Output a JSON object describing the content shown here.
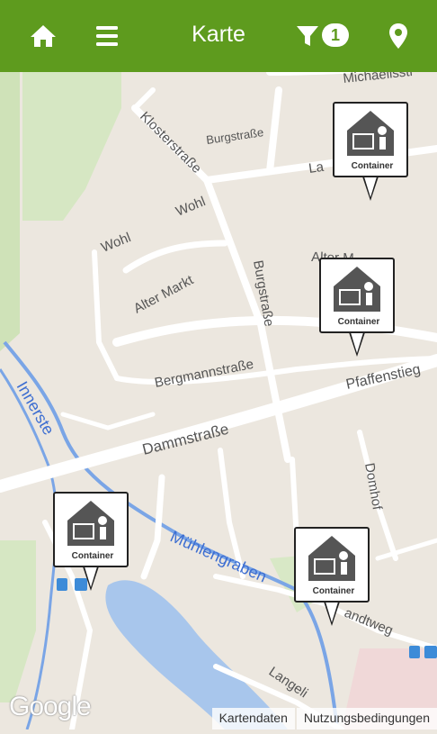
{
  "header": {
    "title": "Karte",
    "filter_count": "1",
    "colors": {
      "bar": "#5e9b1e",
      "text": "#ffffff"
    },
    "icons": [
      "home-icon",
      "menu-icon",
      "filter-icon",
      "location-icon"
    ]
  },
  "map": {
    "streets": {
      "michaelisstr": "Michaelisstr",
      "klosterstrasse": "Klosterstraße",
      "burgstrasse_top": "Burgstraße",
      "lange": "La",
      "wohl1": "Wohl",
      "wohl2": "Wohl",
      "alter_markt_left": "Alter Markt",
      "alter_markt_right": "Alter M",
      "burgstrasse_vert": "Burgstraße",
      "pfaffenstieg": "Pfaffenstieg",
      "bergmannstrasse": "Bergmannstraße",
      "dammstrasse": "Dammstraße",
      "domhof": "Domhof",
      "landweg": "andtweg",
      "langelinie": "Langeli"
    },
    "water": {
      "innerste": "Innerste",
      "muehlengraben": "Mühlengraben"
    },
    "markers": [
      {
        "label": "Container"
      },
      {
        "label": "Container"
      },
      {
        "label": "Container"
      },
      {
        "label": "Container"
      }
    ],
    "logo": "Google",
    "footer": {
      "kartendaten": "Kartendaten",
      "nutzungsbedingungen": "Nutzungsbedingungen"
    }
  }
}
